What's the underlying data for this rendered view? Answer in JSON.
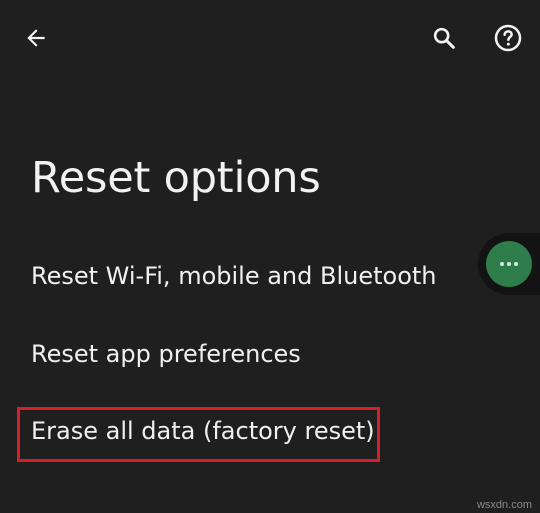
{
  "toolbar": {
    "back_icon": "arrow-back-icon",
    "search_icon": "search-icon",
    "help_icon": "help-circle-icon"
  },
  "page": {
    "title": "Reset options"
  },
  "options": [
    {
      "label": "Reset Wi-Fi, mobile and Bluetooth"
    },
    {
      "label": "Reset app preferences"
    },
    {
      "label": "Erase all data (factory reset)",
      "highlighted": true
    }
  ],
  "floating_bubble": {
    "icon": "more-horizontal-icon"
  },
  "watermark": "wsxdn.com",
  "colors": {
    "background": "#1f1f1f",
    "text": "#f0f0f0",
    "highlight_border": "#d5202c",
    "bubble": "#2e7d4a"
  }
}
